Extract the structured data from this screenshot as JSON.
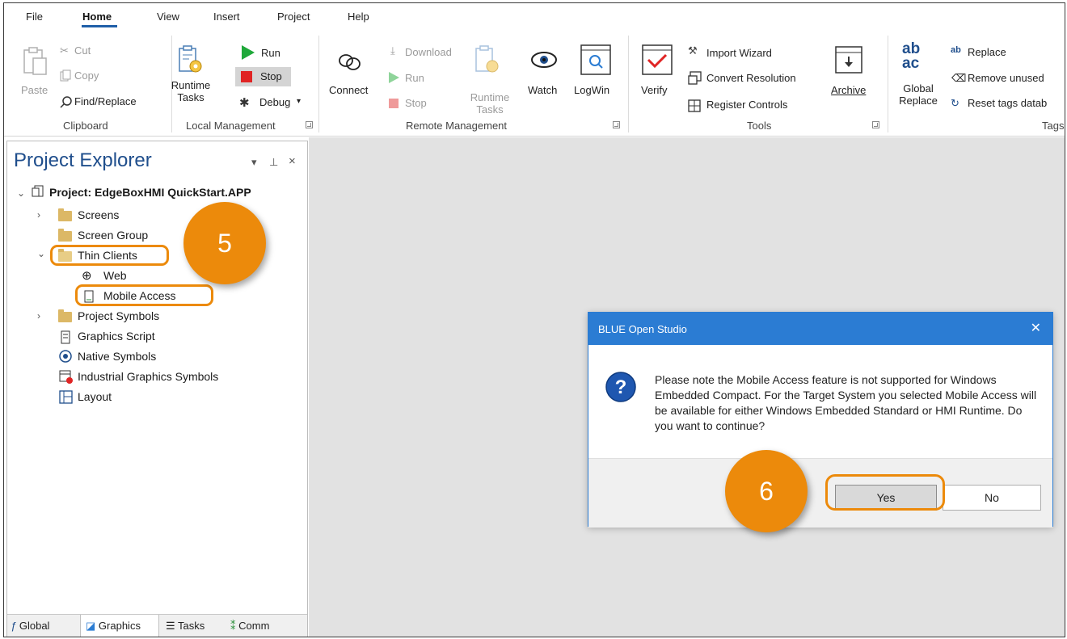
{
  "menu": [
    "File",
    "Home",
    "View",
    "Insert",
    "Project",
    "Help"
  ],
  "ribbon": {
    "clipboard": {
      "paste": "Paste",
      "cut": "Cut",
      "copy": "Copy",
      "find_replace": "Find/Replace",
      "label": "Clipboard"
    },
    "local": {
      "runtime_tasks_1": "Runtime",
      "runtime_tasks_2": "Tasks",
      "run": "Run",
      "stop": "Stop",
      "debug": "Debug",
      "label": "Local Management"
    },
    "remote": {
      "connect": "Connect",
      "download": "Download",
      "run": "Run",
      "stop": "Stop",
      "runtime_tasks_1": "Runtime",
      "runtime_tasks_2": "Tasks",
      "watch": "Watch",
      "logwin": "LogWin",
      "label": "Remote Management"
    },
    "tools": {
      "verify": "Verify",
      "import_wizard": "Import Wizard",
      "convert_resolution": "Convert Resolution",
      "register_controls": "Register Controls",
      "archive": "Archive",
      "label": "Tools"
    },
    "tags": {
      "global_1": "Global",
      "global_2": "Replace",
      "replace": "Replace",
      "remove_unused": "Remove unused",
      "reset_tags": "Reset tags datab",
      "label": "Tags"
    }
  },
  "explorer": {
    "title": "Project Explorer",
    "project": "Project: EdgeBoxHMI QuickStart.APP",
    "items": [
      "Screens",
      "Screen Group",
      "Thin Clients",
      "Web",
      "Mobile Access",
      "Project Symbols",
      "Graphics Script",
      "Native Symbols",
      "Industrial Graphics Symbols",
      "Layout"
    ],
    "tabs": [
      "Global",
      "Graphics",
      "Tasks",
      "Comm"
    ]
  },
  "dialog": {
    "title": "BLUE Open Studio",
    "message": "Please note the Mobile Access feature is not supported for Windows Embedded Compact. For the Target System you selected Mobile Access will be available for either Windows Embedded Standard or HMI Runtime. Do you want to continue?",
    "yes": "Yes",
    "no": "No"
  },
  "callouts": [
    "5",
    "6"
  ],
  "colors": {
    "accent": "#1f5fa8",
    "dialog_title": "#2b7cd3",
    "callout": "#ec8a0b",
    "explorer_title": "#1f4e8c"
  }
}
